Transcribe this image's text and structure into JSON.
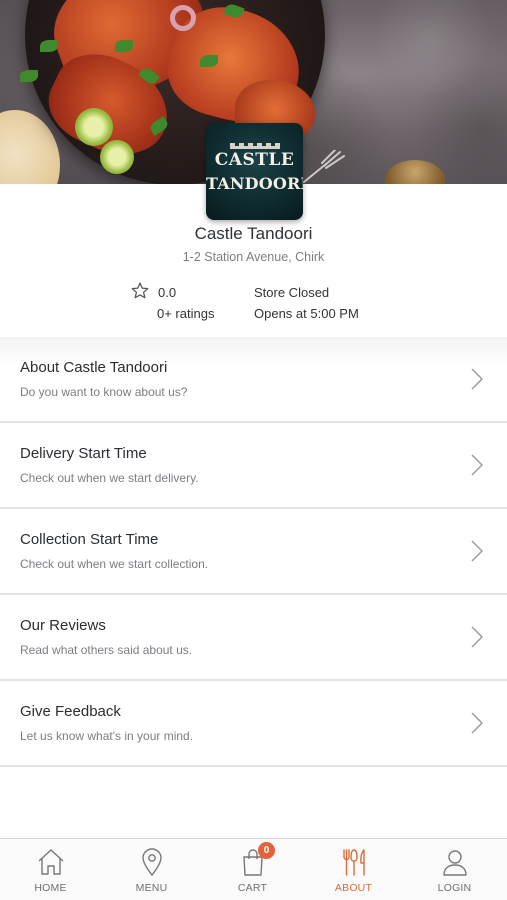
{
  "restaurant": {
    "logo_line1": "CASTLE",
    "logo_line2": "TANDOORI",
    "name": "Castle Tandoori",
    "address": "1-2 Station Avenue, Chirk",
    "rating_value": "0.0",
    "rating_count": "0+ ratings",
    "store_status": "Store Closed",
    "opens_at": "Opens at 5:00 PM"
  },
  "menu": [
    {
      "title": "About Castle Tandoori",
      "subtitle": "Do you want to know about us?"
    },
    {
      "title": "Delivery Start Time",
      "subtitle": "Check out when we start delivery."
    },
    {
      "title": "Collection Start Time",
      "subtitle": "Check out when we start collection."
    },
    {
      "title": "Our Reviews",
      "subtitle": "Read what others said about us."
    },
    {
      "title": "Give Feedback",
      "subtitle": "Let us know what's in your mind."
    }
  ],
  "nav": {
    "items": [
      {
        "label": "HOME",
        "icon": "home-icon"
      },
      {
        "label": "MENU",
        "icon": "map-pin-icon"
      },
      {
        "label": "CART",
        "icon": "shopping-bag-icon",
        "badge": "0"
      },
      {
        "label": "ABOUT",
        "icon": "fork-knife-icon",
        "active": true
      },
      {
        "label": "LOGIN",
        "icon": "user-icon"
      }
    ]
  },
  "colors": {
    "accent": "#e06a3a",
    "badge": "#e3623a",
    "logo_background": "#0e2a2e",
    "divider": "#e4e4e4"
  }
}
